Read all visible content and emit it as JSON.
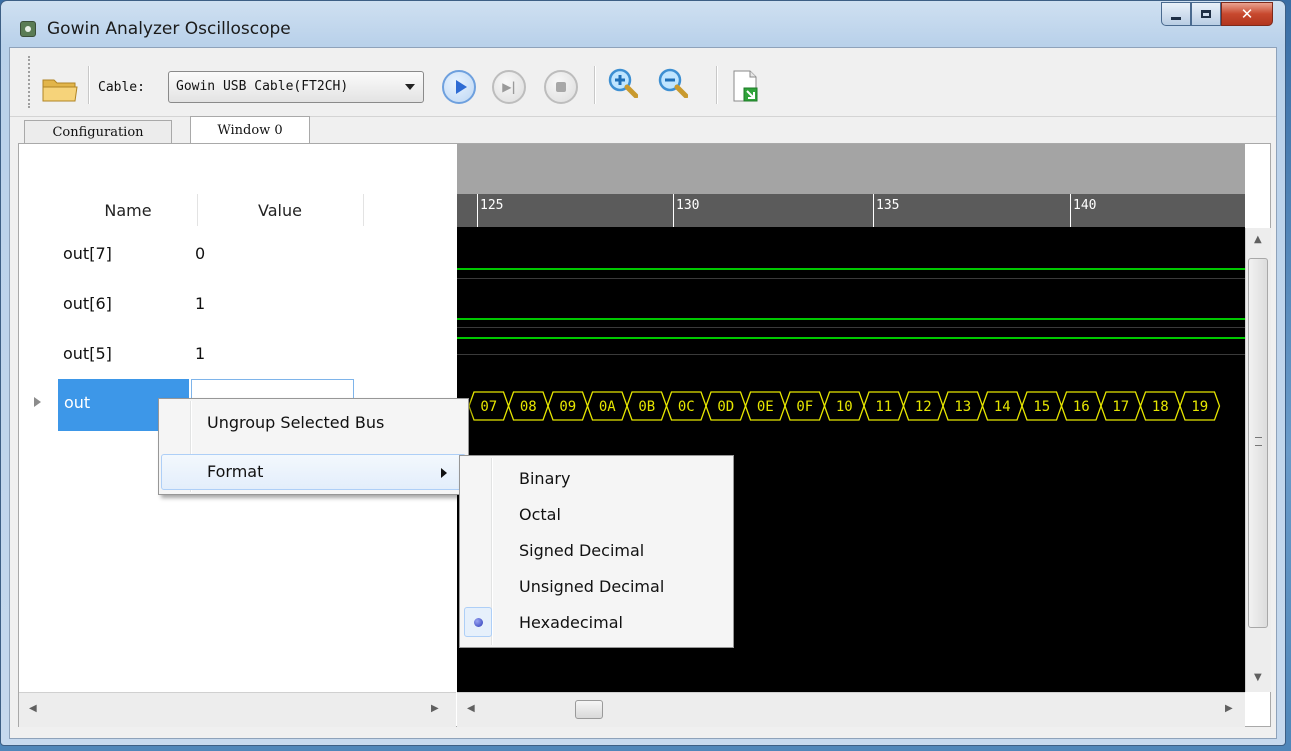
{
  "window": {
    "title": "Gowin Analyzer Oscilloscope"
  },
  "toolbar": {
    "cable_label": "Cable:",
    "cable_value": "Gowin USB Cable(FT2CH)",
    "step_glyph": "▶|"
  },
  "tabs": [
    {
      "label": "Configuration"
    },
    {
      "label": "Window 0"
    }
  ],
  "table": {
    "headers": {
      "name": "Name",
      "value": "Value"
    },
    "rows": [
      {
        "name": "out[7]",
        "value": "0"
      },
      {
        "name": "out[6]",
        "value": "1"
      },
      {
        "name": "out[5]",
        "value": "1"
      },
      {
        "name": "out",
        "value": ""
      }
    ]
  },
  "waveform": {
    "ruler_ticks": [
      "125",
      "130",
      "135",
      "140"
    ],
    "bus_values": [
      "07",
      "08",
      "09",
      "0A",
      "0B",
      "0C",
      "0D",
      "0E",
      "0F",
      "10",
      "11",
      "12",
      "13",
      "14",
      "15",
      "16",
      "17",
      "18",
      "19"
    ],
    "trace_color": "#00c800",
    "bus_color": "#e6e600"
  },
  "context_menu": {
    "items": [
      {
        "label": "Ungroup Selected Bus"
      },
      {
        "label": "Format"
      }
    ]
  },
  "format_submenu": {
    "items": [
      {
        "label": "Binary"
      },
      {
        "label": "Octal"
      },
      {
        "label": "Signed Decimal"
      },
      {
        "label": "Unsigned Decimal"
      },
      {
        "label": "Hexadecimal",
        "selected": true
      }
    ]
  }
}
